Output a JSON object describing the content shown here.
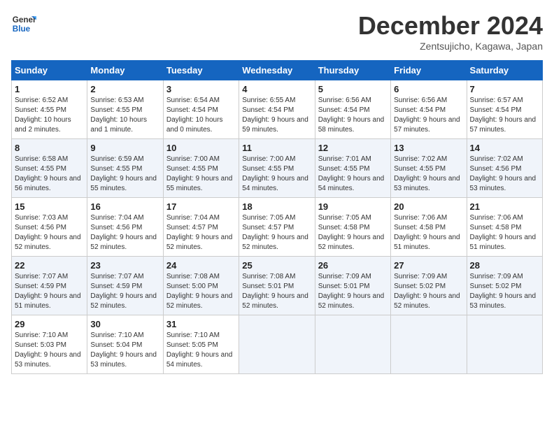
{
  "header": {
    "logo_line1": "General",
    "logo_line2": "Blue",
    "month": "December 2024",
    "location": "Zentsujicho, Kagawa, Japan"
  },
  "weekdays": [
    "Sunday",
    "Monday",
    "Tuesday",
    "Wednesday",
    "Thursday",
    "Friday",
    "Saturday"
  ],
  "weeks": [
    [
      {
        "day": "1",
        "sunrise": "Sunrise: 6:52 AM",
        "sunset": "Sunset: 4:55 PM",
        "daylight": "Daylight: 10 hours and 2 minutes."
      },
      {
        "day": "2",
        "sunrise": "Sunrise: 6:53 AM",
        "sunset": "Sunset: 4:55 PM",
        "daylight": "Daylight: 10 hours and 1 minute."
      },
      {
        "day": "3",
        "sunrise": "Sunrise: 6:54 AM",
        "sunset": "Sunset: 4:54 PM",
        "daylight": "Daylight: 10 hours and 0 minutes."
      },
      {
        "day": "4",
        "sunrise": "Sunrise: 6:55 AM",
        "sunset": "Sunset: 4:54 PM",
        "daylight": "Daylight: 9 hours and 59 minutes."
      },
      {
        "day": "5",
        "sunrise": "Sunrise: 6:56 AM",
        "sunset": "Sunset: 4:54 PM",
        "daylight": "Daylight: 9 hours and 58 minutes."
      },
      {
        "day": "6",
        "sunrise": "Sunrise: 6:56 AM",
        "sunset": "Sunset: 4:54 PM",
        "daylight": "Daylight: 9 hours and 57 minutes."
      },
      {
        "day": "7",
        "sunrise": "Sunrise: 6:57 AM",
        "sunset": "Sunset: 4:54 PM",
        "daylight": "Daylight: 9 hours and 57 minutes."
      }
    ],
    [
      {
        "day": "8",
        "sunrise": "Sunrise: 6:58 AM",
        "sunset": "Sunset: 4:55 PM",
        "daylight": "Daylight: 9 hours and 56 minutes."
      },
      {
        "day": "9",
        "sunrise": "Sunrise: 6:59 AM",
        "sunset": "Sunset: 4:55 PM",
        "daylight": "Daylight: 9 hours and 55 minutes."
      },
      {
        "day": "10",
        "sunrise": "Sunrise: 7:00 AM",
        "sunset": "Sunset: 4:55 PM",
        "daylight": "Daylight: 9 hours and 55 minutes."
      },
      {
        "day": "11",
        "sunrise": "Sunrise: 7:00 AM",
        "sunset": "Sunset: 4:55 PM",
        "daylight": "Daylight: 9 hours and 54 minutes."
      },
      {
        "day": "12",
        "sunrise": "Sunrise: 7:01 AM",
        "sunset": "Sunset: 4:55 PM",
        "daylight": "Daylight: 9 hours and 54 minutes."
      },
      {
        "day": "13",
        "sunrise": "Sunrise: 7:02 AM",
        "sunset": "Sunset: 4:55 PM",
        "daylight": "Daylight: 9 hours and 53 minutes."
      },
      {
        "day": "14",
        "sunrise": "Sunrise: 7:02 AM",
        "sunset": "Sunset: 4:56 PM",
        "daylight": "Daylight: 9 hours and 53 minutes."
      }
    ],
    [
      {
        "day": "15",
        "sunrise": "Sunrise: 7:03 AM",
        "sunset": "Sunset: 4:56 PM",
        "daylight": "Daylight: 9 hours and 52 minutes."
      },
      {
        "day": "16",
        "sunrise": "Sunrise: 7:04 AM",
        "sunset": "Sunset: 4:56 PM",
        "daylight": "Daylight: 9 hours and 52 minutes."
      },
      {
        "day": "17",
        "sunrise": "Sunrise: 7:04 AM",
        "sunset": "Sunset: 4:57 PM",
        "daylight": "Daylight: 9 hours and 52 minutes."
      },
      {
        "day": "18",
        "sunrise": "Sunrise: 7:05 AM",
        "sunset": "Sunset: 4:57 PM",
        "daylight": "Daylight: 9 hours and 52 minutes."
      },
      {
        "day": "19",
        "sunrise": "Sunrise: 7:05 AM",
        "sunset": "Sunset: 4:58 PM",
        "daylight": "Daylight: 9 hours and 52 minutes."
      },
      {
        "day": "20",
        "sunrise": "Sunrise: 7:06 AM",
        "sunset": "Sunset: 4:58 PM",
        "daylight": "Daylight: 9 hours and 51 minutes."
      },
      {
        "day": "21",
        "sunrise": "Sunrise: 7:06 AM",
        "sunset": "Sunset: 4:58 PM",
        "daylight": "Daylight: 9 hours and 51 minutes."
      }
    ],
    [
      {
        "day": "22",
        "sunrise": "Sunrise: 7:07 AM",
        "sunset": "Sunset: 4:59 PM",
        "daylight": "Daylight: 9 hours and 51 minutes."
      },
      {
        "day": "23",
        "sunrise": "Sunrise: 7:07 AM",
        "sunset": "Sunset: 4:59 PM",
        "daylight": "Daylight: 9 hours and 52 minutes."
      },
      {
        "day": "24",
        "sunrise": "Sunrise: 7:08 AM",
        "sunset": "Sunset: 5:00 PM",
        "daylight": "Daylight: 9 hours and 52 minutes."
      },
      {
        "day": "25",
        "sunrise": "Sunrise: 7:08 AM",
        "sunset": "Sunset: 5:01 PM",
        "daylight": "Daylight: 9 hours and 52 minutes."
      },
      {
        "day": "26",
        "sunrise": "Sunrise: 7:09 AM",
        "sunset": "Sunset: 5:01 PM",
        "daylight": "Daylight: 9 hours and 52 minutes."
      },
      {
        "day": "27",
        "sunrise": "Sunrise: 7:09 AM",
        "sunset": "Sunset: 5:02 PM",
        "daylight": "Daylight: 9 hours and 52 minutes."
      },
      {
        "day": "28",
        "sunrise": "Sunrise: 7:09 AM",
        "sunset": "Sunset: 5:02 PM",
        "daylight": "Daylight: 9 hours and 53 minutes."
      }
    ],
    [
      {
        "day": "29",
        "sunrise": "Sunrise: 7:10 AM",
        "sunset": "Sunset: 5:03 PM",
        "daylight": "Daylight: 9 hours and 53 minutes."
      },
      {
        "day": "30",
        "sunrise": "Sunrise: 7:10 AM",
        "sunset": "Sunset: 5:04 PM",
        "daylight": "Daylight: 9 hours and 53 minutes."
      },
      {
        "day": "31",
        "sunrise": "Sunrise: 7:10 AM",
        "sunset": "Sunset: 5:05 PM",
        "daylight": "Daylight: 9 hours and 54 minutes."
      },
      null,
      null,
      null,
      null
    ]
  ]
}
